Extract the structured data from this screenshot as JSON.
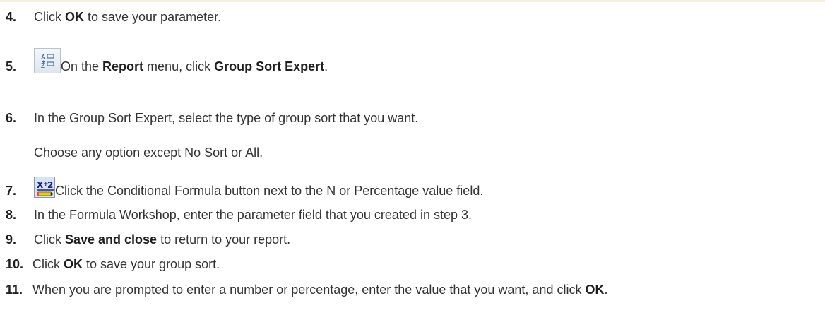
{
  "steps": [
    {
      "num": "4.",
      "pre": "Click ",
      "b1": "OK",
      "post": " to save your parameter."
    },
    {
      "num": "5.",
      "pre": "On the ",
      "b1": "Report",
      "mid": " menu, click ",
      "b2": "Group Sort Expert",
      "post": "."
    },
    {
      "num": "6.",
      "text": "In the Group Sort Expert, select the type of group sort that you want."
    },
    {
      "num": "7.",
      "text": "Click the Conditional Formula button next to the N or Percentage value field."
    },
    {
      "num": "8.",
      "text": "In the Formula Workshop, enter the parameter field that you created in step 3."
    },
    {
      "num": "9.",
      "pre": "Click ",
      "b1": "Save and close",
      "post": " to return to your report."
    },
    {
      "num": "10.",
      "pre": "Click ",
      "b1": "OK",
      "post": " to save your group sort."
    },
    {
      "num": "11.",
      "pre": "When you are prompted to enter a number or percentage, enter the value that you want, and click ",
      "b1": "OK",
      "post": "."
    }
  ],
  "note": "Choose any option except No Sort or All.",
  "icons": {
    "step5": "group-sort-expert-icon",
    "step7": "conditional-formula-icon"
  }
}
